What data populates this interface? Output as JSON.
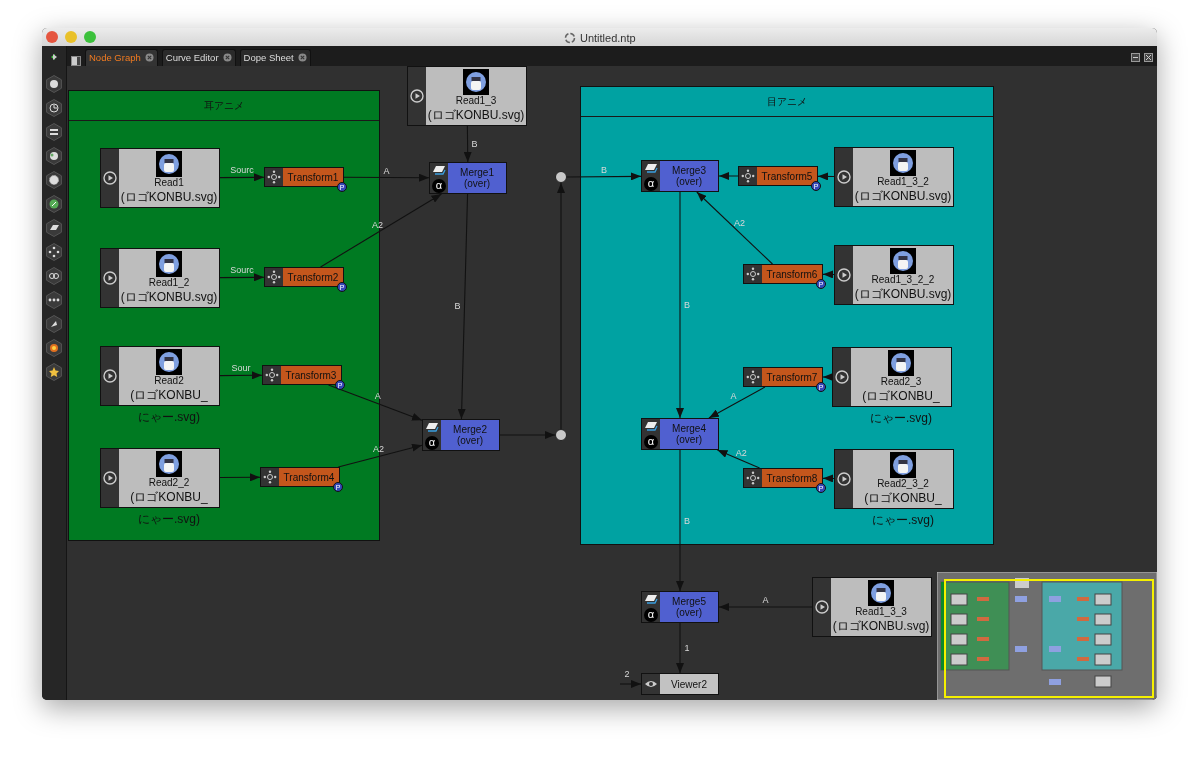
{
  "window": {
    "title": "Untitled.ntp"
  },
  "tabs": [
    {
      "label": "Node Graph",
      "selected": true
    },
    {
      "label": "Curve Editor",
      "selected": false
    },
    {
      "label": "Dope Sheet",
      "selected": false
    }
  ],
  "backdrops": [
    {
      "title": "耳アニメ",
      "color": "#007a22"
    },
    {
      "title": "目アニメ",
      "color": "#00a2a2"
    }
  ],
  "nodes": [
    {
      "kind": "read",
      "name": "Read1_3",
      "file": [
        "(ロゴKONBU.svg)"
      ]
    },
    {
      "kind": "read",
      "name": "Read1",
      "file": [
        "(ロゴKONBU.svg)"
      ]
    },
    {
      "kind": "transform",
      "name": "Transform1",
      "badge": "P"
    },
    {
      "kind": "merge",
      "name": "Merge1",
      "operator": "(over)",
      "mask": "α"
    },
    {
      "kind": "read",
      "name": "Read1_2",
      "file": [
        "(ロゴKONBU.svg)"
      ]
    },
    {
      "kind": "transform",
      "name": "Transform2",
      "badge": "P"
    },
    {
      "kind": "read",
      "name": "Read2",
      "file": [
        "(ロゴKONBU_",
        "にゃー.svg)"
      ]
    },
    {
      "kind": "transform",
      "name": "Transform3",
      "badge": "P"
    },
    {
      "kind": "merge",
      "name": "Merge2",
      "operator": "(over)",
      "mask": "α"
    },
    {
      "kind": "read",
      "name": "Read2_2",
      "file": [
        "(ロゴKONBU_",
        "にゃー.svg)"
      ]
    },
    {
      "kind": "transform",
      "name": "Transform4",
      "badge": "P"
    },
    {
      "kind": "dot"
    },
    {
      "kind": "dot"
    },
    {
      "kind": "merge",
      "name": "Merge3",
      "operator": "(over)",
      "mask": "α"
    },
    {
      "kind": "transform",
      "name": "Transform5",
      "badge": "P"
    },
    {
      "kind": "read",
      "name": "Read1_3_2",
      "file": [
        "(ロゴKONBU.svg)"
      ]
    },
    {
      "kind": "transform",
      "name": "Transform6",
      "badge": "P"
    },
    {
      "kind": "read",
      "name": "Read1_3_2_2",
      "file": [
        "(ロゴKONBU.svg)"
      ]
    },
    {
      "kind": "transform",
      "name": "Transform7",
      "badge": "P"
    },
    {
      "kind": "read",
      "name": "Read2_3",
      "file": [
        "(ロゴKONBU_",
        "にゃー.svg)"
      ]
    },
    {
      "kind": "merge",
      "name": "Merge4",
      "operator": "(over)",
      "mask": "α"
    },
    {
      "kind": "transform",
      "name": "Transform8",
      "badge": "P"
    },
    {
      "kind": "read",
      "name": "Read2_3_2",
      "file": [
        "(ロゴKONBU_",
        "にゃー.svg)"
      ]
    },
    {
      "kind": "merge",
      "name": "Merge5",
      "operator": "(over)",
      "mask": "α"
    },
    {
      "kind": "read",
      "name": "Read1_3_3",
      "file": [
        "(ロゴKONBU.svg)"
      ]
    },
    {
      "kind": "viewer",
      "name": "Viewer2",
      "input": "2"
    }
  ],
  "edges": [
    {
      "label": "Sourc"
    },
    {
      "label": "Sourc"
    },
    {
      "label": "Sour"
    },
    {
      "label": "A"
    },
    {
      "label": "A2"
    },
    {
      "label": "B"
    },
    {
      "label": "B"
    },
    {
      "label": "A"
    },
    {
      "label": "A2"
    },
    {
      "label": "B"
    },
    {
      "label": "A2"
    },
    {
      "label": "A"
    },
    {
      "label": "A2"
    },
    {
      "label": "B"
    },
    {
      "label": "B"
    },
    {
      "label": "A"
    },
    {
      "label": "1"
    }
  ]
}
